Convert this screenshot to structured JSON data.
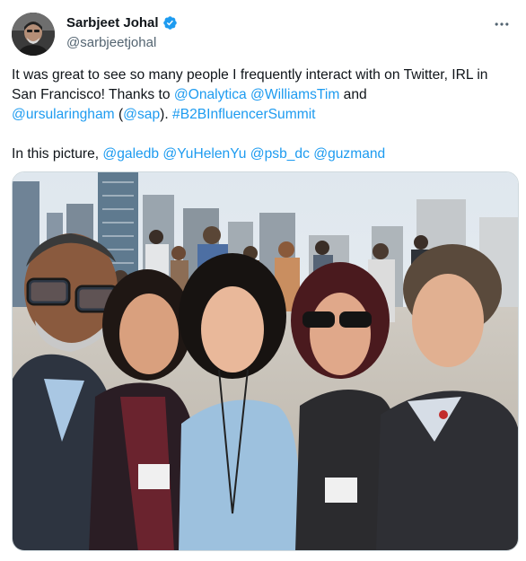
{
  "tweet": {
    "author": {
      "display_name": "Sarbjeet Johal",
      "handle": "@sarbjeetjohal",
      "verified": true,
      "avatar_icon": "profile-photo"
    },
    "more_icon": "more-horizontal-icon",
    "text": {
      "p1_a": "It was great to see so many people I frequently interact with on Twitter, IRL in San Francisco! Thanks to ",
      "mention_onalytica": "@Onalytica",
      "p1_b": " ",
      "mention_williamstim": "@WilliamsTim",
      "p1_c": " and ",
      "mention_ursularingham": "@ursularingham",
      "p1_d": " (",
      "mention_sap": "@sap",
      "p1_e": "). ",
      "hashtag": "#B2BInfluencerSummit",
      "p2_a": "In this picture, ",
      "mention_galedb": "@galedb",
      "mention_yuhelenyu": "@YuHelenYu",
      "mention_psb_dc": "@psb_dc",
      "mention_guzmand": "@guzmand",
      "space": " "
    },
    "media": {
      "type": "photo",
      "description_icon": "group-selfie-photo"
    }
  },
  "colors": {
    "link": "#1d9bf0",
    "text": "#0f1419",
    "secondary": "#536471",
    "verified": "#1d9bf0",
    "border": "#cfd9de"
  }
}
